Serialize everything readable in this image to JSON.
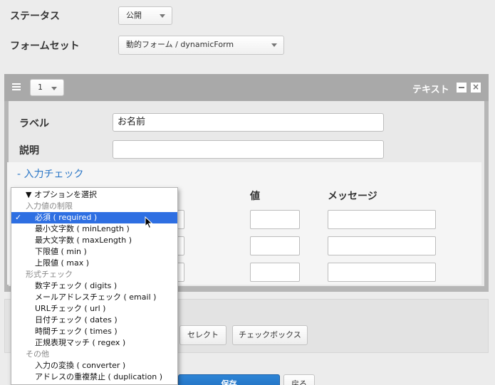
{
  "status": {
    "label": "ステータス",
    "value": "公開"
  },
  "formset": {
    "label": "フォームセット",
    "value": "動的フォーム / dynamicForm"
  },
  "panel": {
    "order_value": "1",
    "type_label": "テキスト",
    "label_field": {
      "label": "ラベル",
      "value": "お名前"
    },
    "desc_field": {
      "label": "説明",
      "value": ""
    },
    "check_toggle": "- 入力チェック",
    "columns": {
      "value": "値",
      "message": "メッセージ"
    }
  },
  "bottom_buttons": {
    "select": "セレクト",
    "checkbox": "チェックボックス"
  },
  "actions": {
    "save": "保存",
    "back": "戻る"
  },
  "dropdown": {
    "header": "▼ オプションを選択",
    "groups": [
      {
        "name": "入力値の制限",
        "options": [
          "必須 ( required )",
          "最小文字数 ( minLength )",
          "最大文字数 ( maxLength )",
          "下限値 ( min )",
          "上限値 ( max )"
        ]
      },
      {
        "name": "形式チェック",
        "options": [
          "数字チェック ( digits )",
          "メールアドレスチェック ( email )",
          "URLチェック ( url )",
          "日付チェック ( dates )",
          "時間チェック ( times )",
          "正規表現マッチ ( regex )"
        ]
      },
      {
        "name": "その他",
        "options": [
          "入力の変換 ( converter )",
          "アドレスの重複禁止 ( duplication )"
        ]
      }
    ],
    "selected": "必須 ( required )",
    "checkmark": "✓"
  }
}
